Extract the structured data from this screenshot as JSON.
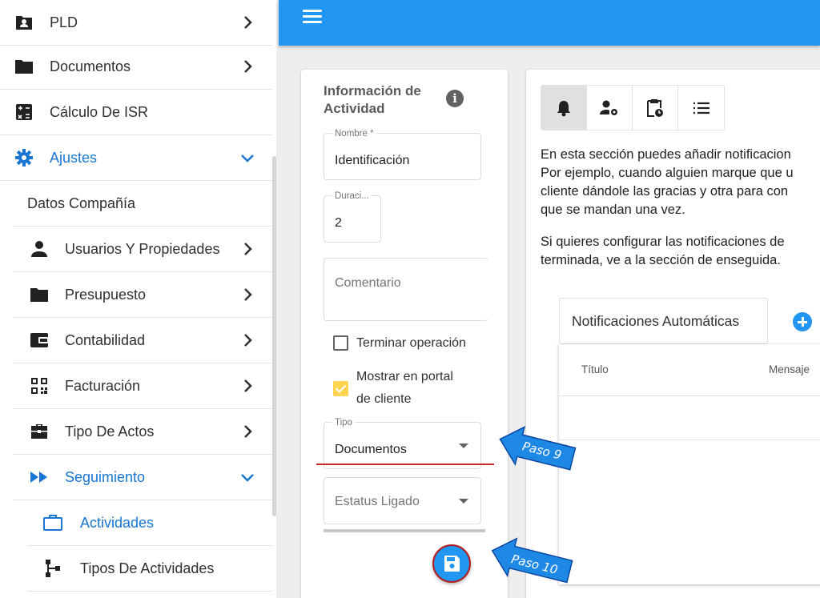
{
  "sidebar": {
    "items": [
      {
        "label": "PLD",
        "icon": "contact-folder-icon"
      },
      {
        "label": "Documentos",
        "icon": "folder-icon"
      },
      {
        "label": "Cálculo De ISR",
        "icon": "calculator-icon"
      },
      {
        "label": "Ajustes",
        "icon": "gear-icon"
      },
      {
        "label": "Datos Compañía"
      },
      {
        "label": "Usuarios Y Propiedades",
        "icon": "person-icon"
      },
      {
        "label": "Presupuesto",
        "icon": "folder-icon"
      },
      {
        "label": "Contabilidad",
        "icon": "wallet-icon"
      },
      {
        "label": "Facturación",
        "icon": "qr-code-icon"
      },
      {
        "label": "Tipo De Actos",
        "icon": "briefcase-icon"
      },
      {
        "label": "Seguimiento",
        "icon": "fast-forward-icon"
      },
      {
        "label": "Actividades",
        "icon": "briefcase-outline-icon"
      },
      {
        "label": "Tipos De Actividades",
        "icon": "hierarchy-icon"
      }
    ]
  },
  "colors": {
    "primary": "#2196f3",
    "active_text": "#1976d2",
    "accent_red": "#c62828",
    "checkbox_yellow": "#ffd54f"
  },
  "form": {
    "title": "Información de Actividad",
    "nombre_label": "Nombre *",
    "nombre_value": "Identificación",
    "duracion_label": "Duraci...",
    "duracion_value": "2",
    "comentario_placeholder": "Comentario",
    "terminar_label": "Terminar operación",
    "mostrar_label_1": "Mostrar en portal",
    "mostrar_label_2": "de cliente",
    "tipo_label": "Tipo",
    "tipo_value": "Documentos",
    "estatus_placeholder": "Estatus Ligado"
  },
  "right": {
    "desc_lines": [
      "En esta sección puedes añadir notificacion",
      "Por ejemplo, cuando alguien marque que u",
      "cliente dándole las gracias y otra para con",
      "que se mandan una vez."
    ],
    "desc2_lines": [
      "Si quieres configurar las notificaciones de",
      "terminada, ve a la sección de enseguida."
    ],
    "tab_label": "Notificaciones Automáticas",
    "columns": [
      "Título",
      "Mensaje"
    ]
  },
  "callouts": {
    "step9": "Paso 9",
    "step10": "Paso 10"
  }
}
